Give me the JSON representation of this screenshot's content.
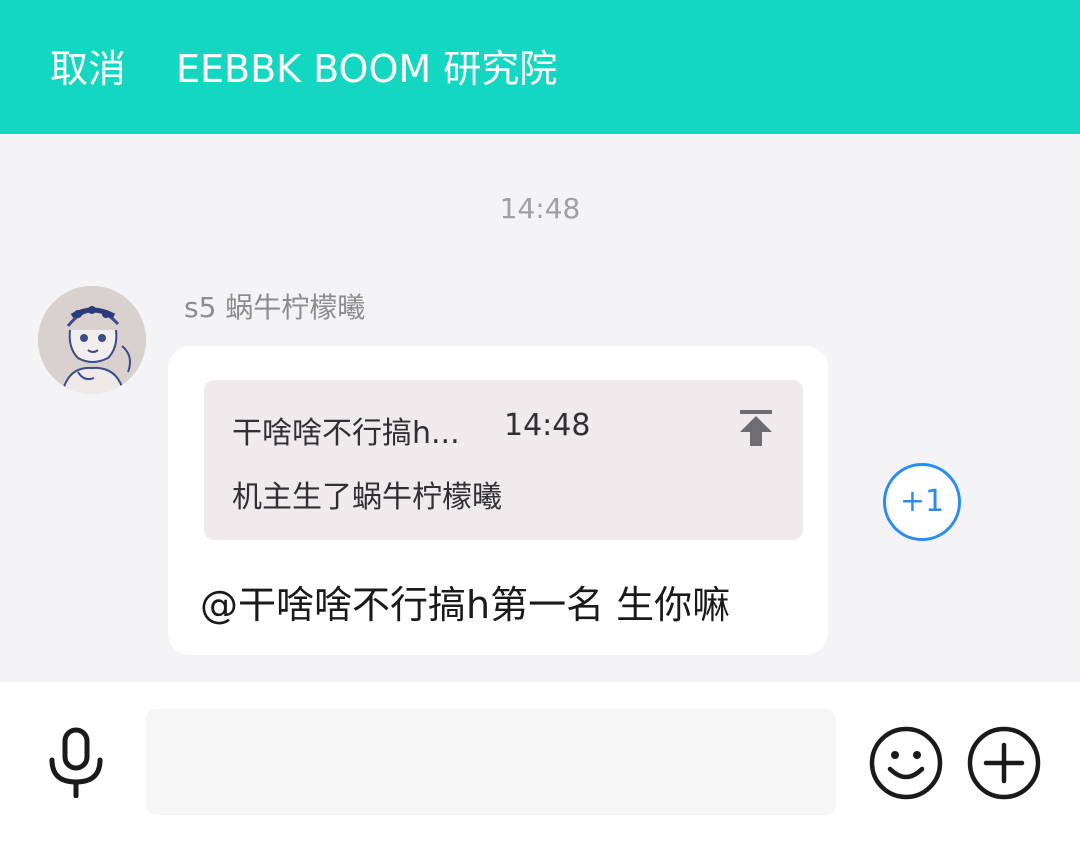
{
  "header": {
    "cancel_label": "取消",
    "title": "EEBBK BOOM 研究院",
    "background_color": "#14D7C1"
  },
  "chat": {
    "timestamp": "14:48",
    "message": {
      "sender": "s5 蜗牛柠檬曦",
      "avatar_icon": "avatar-sketch",
      "quote": {
        "author": "干啥啥不行搞h...",
        "time": "14:48",
        "text": "机主生了蜗牛柠檬曦",
        "icon": "pin-top-icon"
      },
      "text": "@干啥啥不行搞h第一名 生你嘛"
    },
    "plus_one_label": "+1",
    "plus_one_color": "#2A8CF0"
  },
  "input_bar": {
    "mic_icon": "microphone-icon",
    "input_value": "",
    "input_placeholder": "",
    "emoji_icon": "smiley-icon",
    "plus_icon": "plus-circle-icon"
  }
}
